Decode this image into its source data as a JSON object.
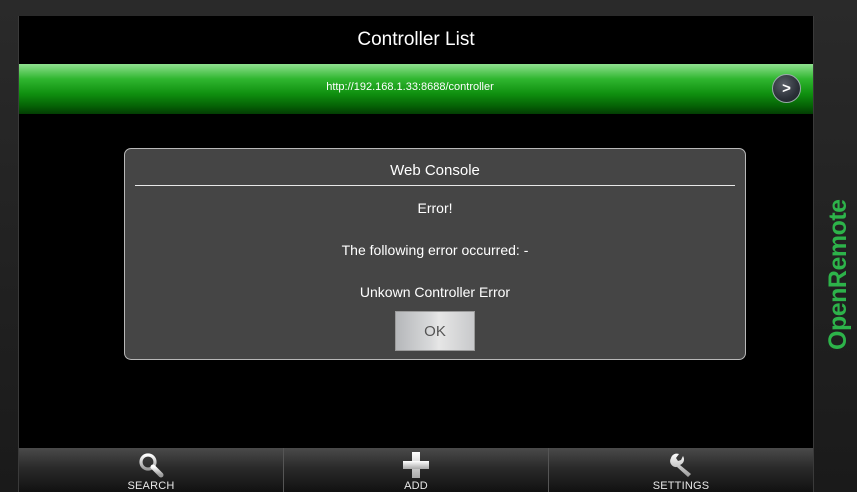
{
  "app": {
    "title": "Controller List"
  },
  "url_bar": {
    "url": "http://192.168.1.33:8688/controller",
    "go_label": ">"
  },
  "dialog": {
    "title": "Web Console",
    "heading": "Error!",
    "message": "The following error occurred: -",
    "detail": "Unkown Controller Error",
    "ok_label": "OK"
  },
  "tabs": [
    {
      "label": "SEARCH",
      "icon": "search-icon"
    },
    {
      "label": "ADD",
      "icon": "plus-icon"
    },
    {
      "label": "SETTINGS",
      "icon": "wrench-icon"
    }
  ],
  "brand": {
    "logo_text": "OpenRemote",
    "color": "#2db34a"
  },
  "colors": {
    "accent_green": "#1fa51f",
    "dialog_bg": "#454545"
  }
}
